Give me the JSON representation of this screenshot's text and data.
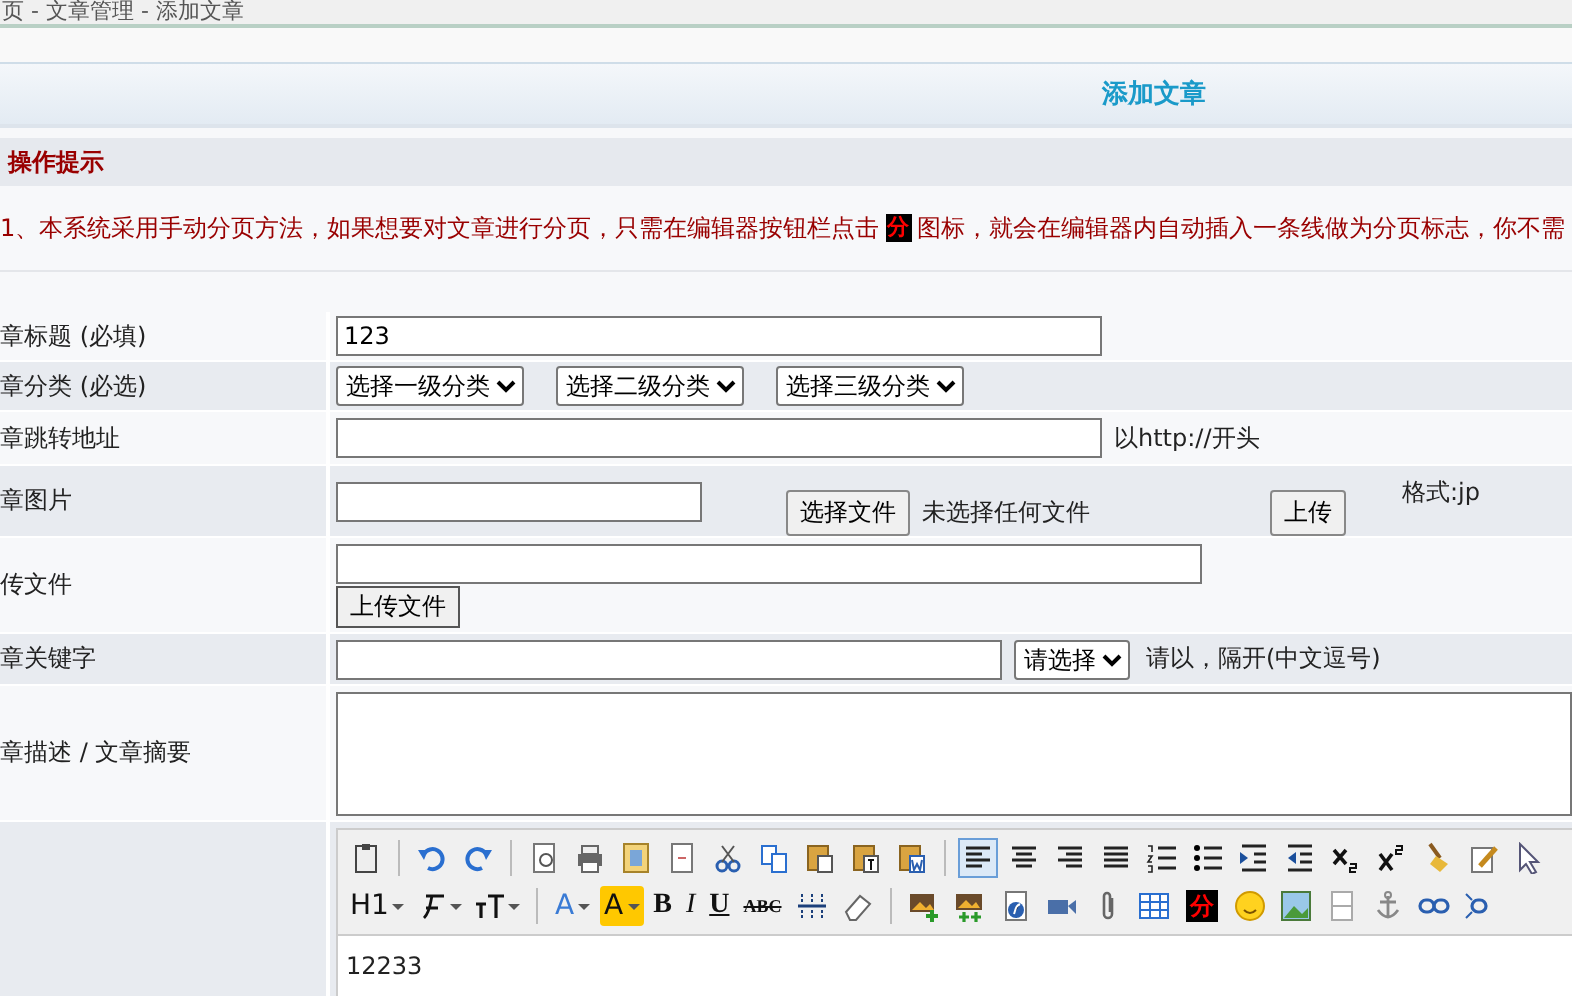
{
  "breadcrumb": "页 - 文章管理 - 添加文章",
  "banner_title": "添加文章",
  "notice": {
    "title": "操作提示",
    "before": "1、本系统采用手动分页方法，如果想要对文章进行分页，只需在编辑器按钮栏点击",
    "icon_char": "分",
    "after": "图标，就会在编辑器内自动插入一条线做为分页标志，你不需"
  },
  "rows": [
    {
      "kind": "text",
      "label": "章标题 (必填)",
      "value": "123"
    },
    {
      "kind": "selects",
      "label": "章分类 (必选)",
      "selects": [
        "选择一级分类",
        "选择二级分类",
        "选择三级分类"
      ]
    },
    {
      "kind": "url",
      "label": "章跳转地址",
      "hint": "以http://开头"
    },
    {
      "kind": "image",
      "label": "章图片",
      "choose": "选择文件",
      "status": "未选择任何文件",
      "upload": "上传",
      "format": "格式:jp"
    },
    {
      "kind": "file",
      "label": "传文件",
      "upload": "上传文件"
    },
    {
      "kind": "keyword",
      "label": "章关键字",
      "select": "请选择",
      "hint": "请以，隔开(中文逗号)"
    },
    {
      "kind": "textarea",
      "label": "章描述 / 文章摘要"
    },
    {
      "kind": "editor",
      "label": ""
    }
  ],
  "editor": {
    "content": "12233",
    "heading": "H1",
    "bold": "B",
    "italic": "I",
    "underline": "U",
    "strike": "ABC",
    "font_color": "A",
    "highlight": "A",
    "page_break": "分",
    "alignment": [
      {
        "selected": true
      },
      {
        "selected": false
      },
      {
        "selected": false
      },
      {
        "selected": false
      }
    ]
  }
}
